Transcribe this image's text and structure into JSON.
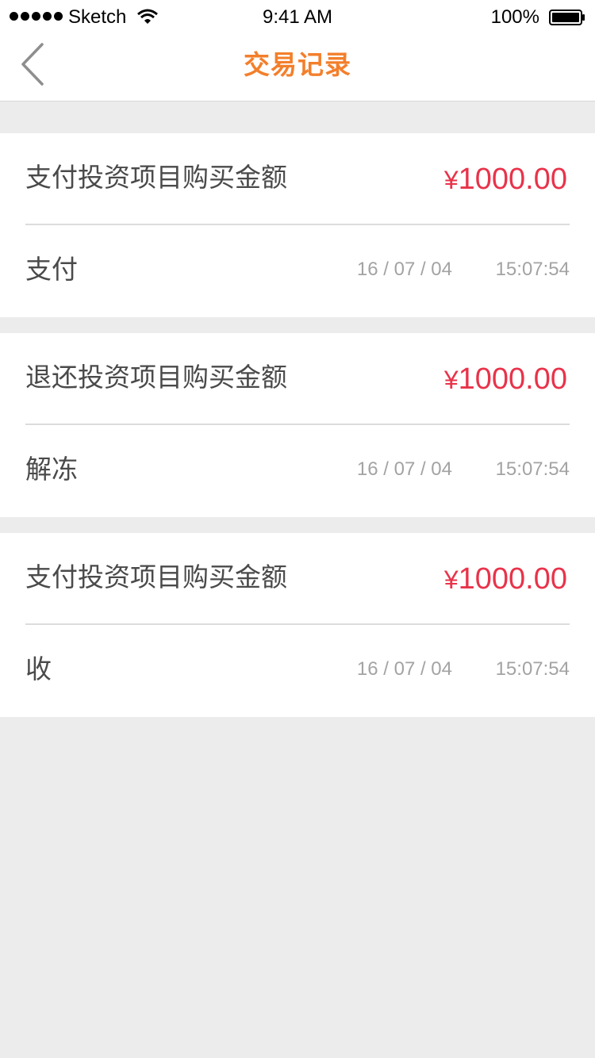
{
  "status_bar": {
    "carrier": "Sketch",
    "time": "9:41 AM",
    "battery": "100%"
  },
  "nav": {
    "title": "交易记录",
    "back_icon": "chevron-left-icon"
  },
  "colors": {
    "accent": "#f37f2b",
    "amount": "#e8334a",
    "text": "#4a4a4a",
    "muted": "#a3a3a3",
    "background": "#ececec"
  },
  "records": [
    {
      "description": "支付投资项目购买金额",
      "currency": "¥",
      "amount": "1000.00",
      "type": "支付",
      "date": "16 / 07 / 04",
      "time": "15:07:54"
    },
    {
      "description": "退还投资项目购买金额",
      "currency": "¥",
      "amount": "1000.00",
      "type": "解冻",
      "date": "16 / 07 / 04",
      "time": "15:07:54"
    },
    {
      "description": "支付投资项目购买金额",
      "currency": "¥",
      "amount": "1000.00",
      "type": "收",
      "date": "16 / 07 / 04",
      "time": "15:07:54"
    }
  ]
}
